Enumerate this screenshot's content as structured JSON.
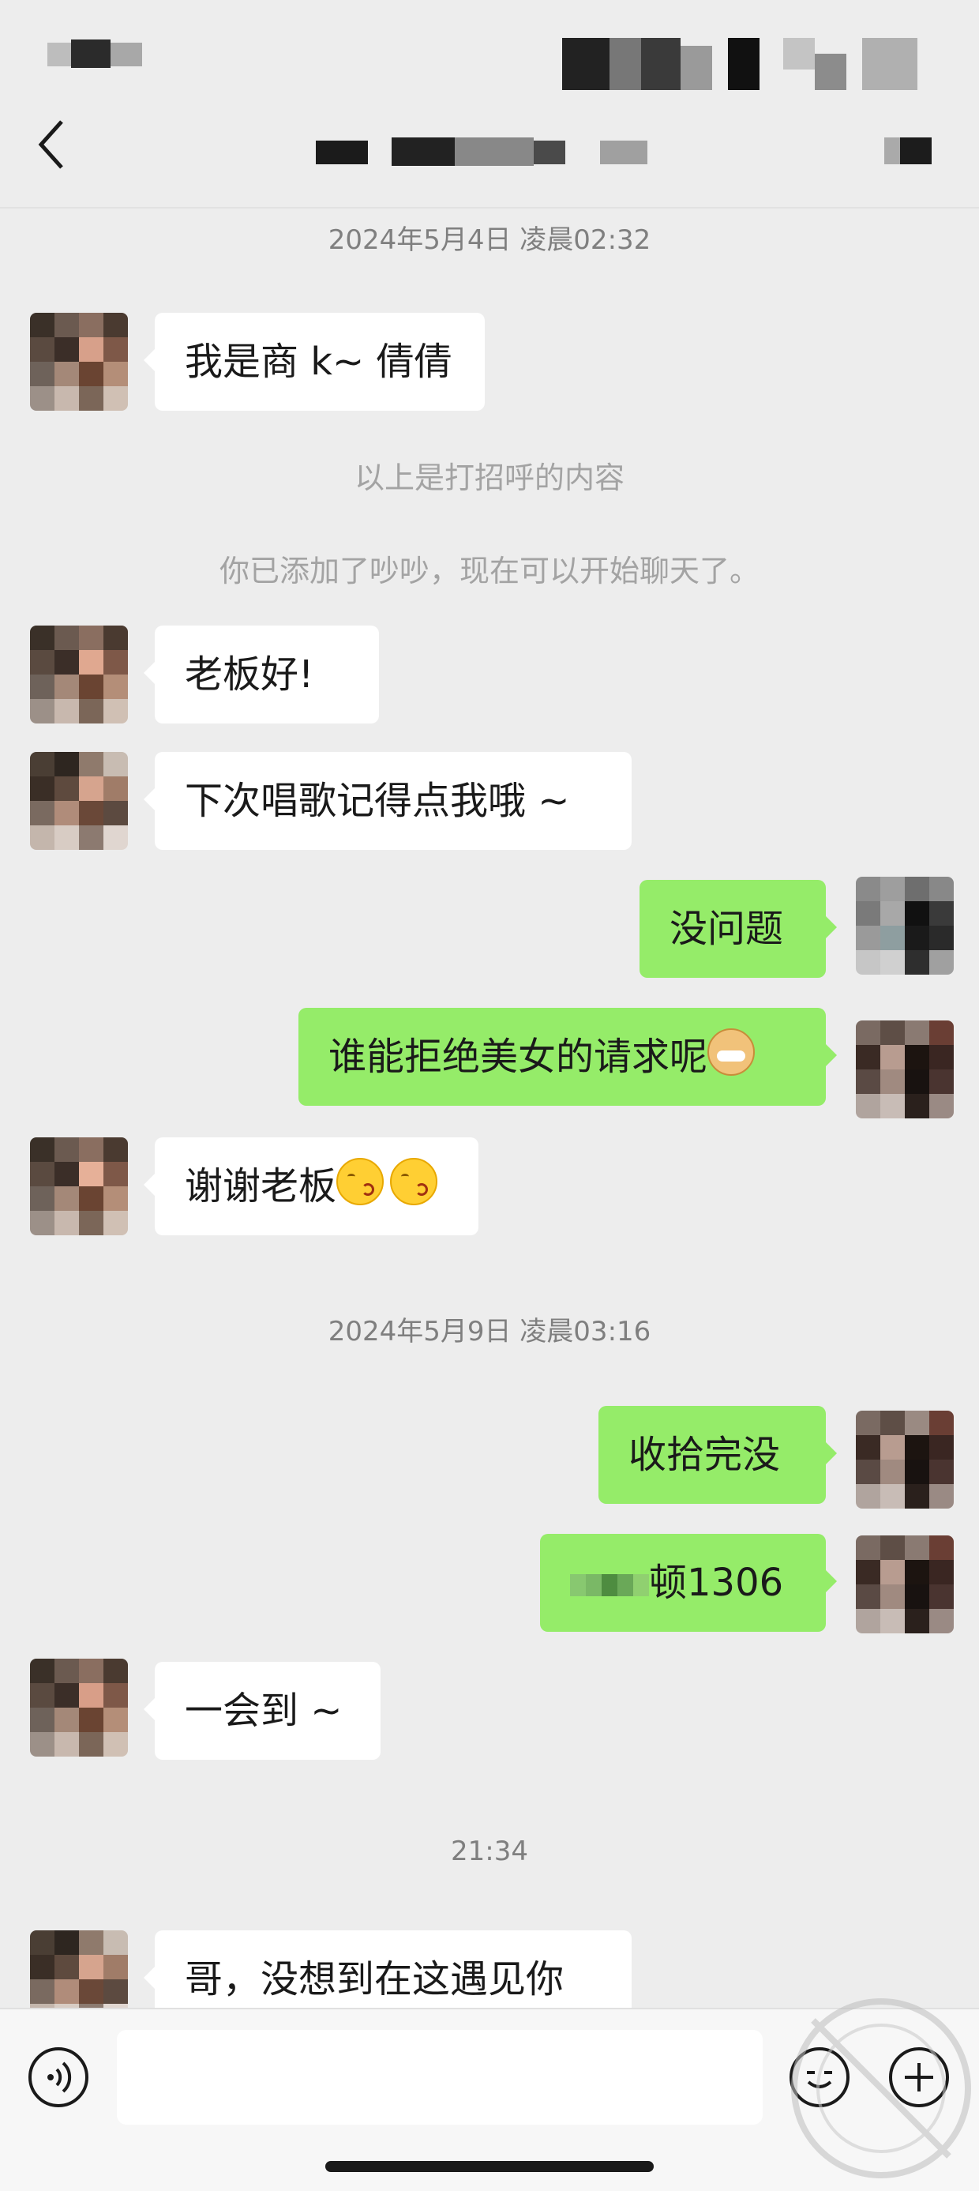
{
  "chat": {
    "timestamps": [
      "2024年5月4日 凌晨02:32",
      "2024年5月9日 凌晨03:16",
      "21:34"
    ],
    "system_messages": [
      "以上是打招呼的内容",
      "你已添加了吵吵，现在可以开始聊天了。"
    ],
    "messages": [
      {
        "side": "left",
        "text": "我是商 k~ 倩倩"
      },
      {
        "side": "left",
        "text": "老板好!"
      },
      {
        "side": "left",
        "text": "下次唱歌记得点我哦 ~"
      },
      {
        "side": "right",
        "text": "没问题"
      },
      {
        "side": "right",
        "text": "谁能拒绝美女的请求呢"
      },
      {
        "side": "left",
        "text": "谢谢老板"
      },
      {
        "side": "right",
        "text": "收拾完没"
      },
      {
        "side": "right",
        "text": "顿1306"
      },
      {
        "side": "left",
        "text": "一会到 ~"
      },
      {
        "side": "left",
        "text": "哥，没想到在这遇见你"
      }
    ]
  },
  "icons": {
    "back": "chevron-left-icon",
    "voice": "voice-icon",
    "emoji": "emoji-icon",
    "plus": "plus-icon",
    "watermark": "watermark-stamp"
  },
  "colors": {
    "background": "#ededed",
    "outgoing_bubble": "#95ec69",
    "incoming_bubble": "#ffffff"
  }
}
